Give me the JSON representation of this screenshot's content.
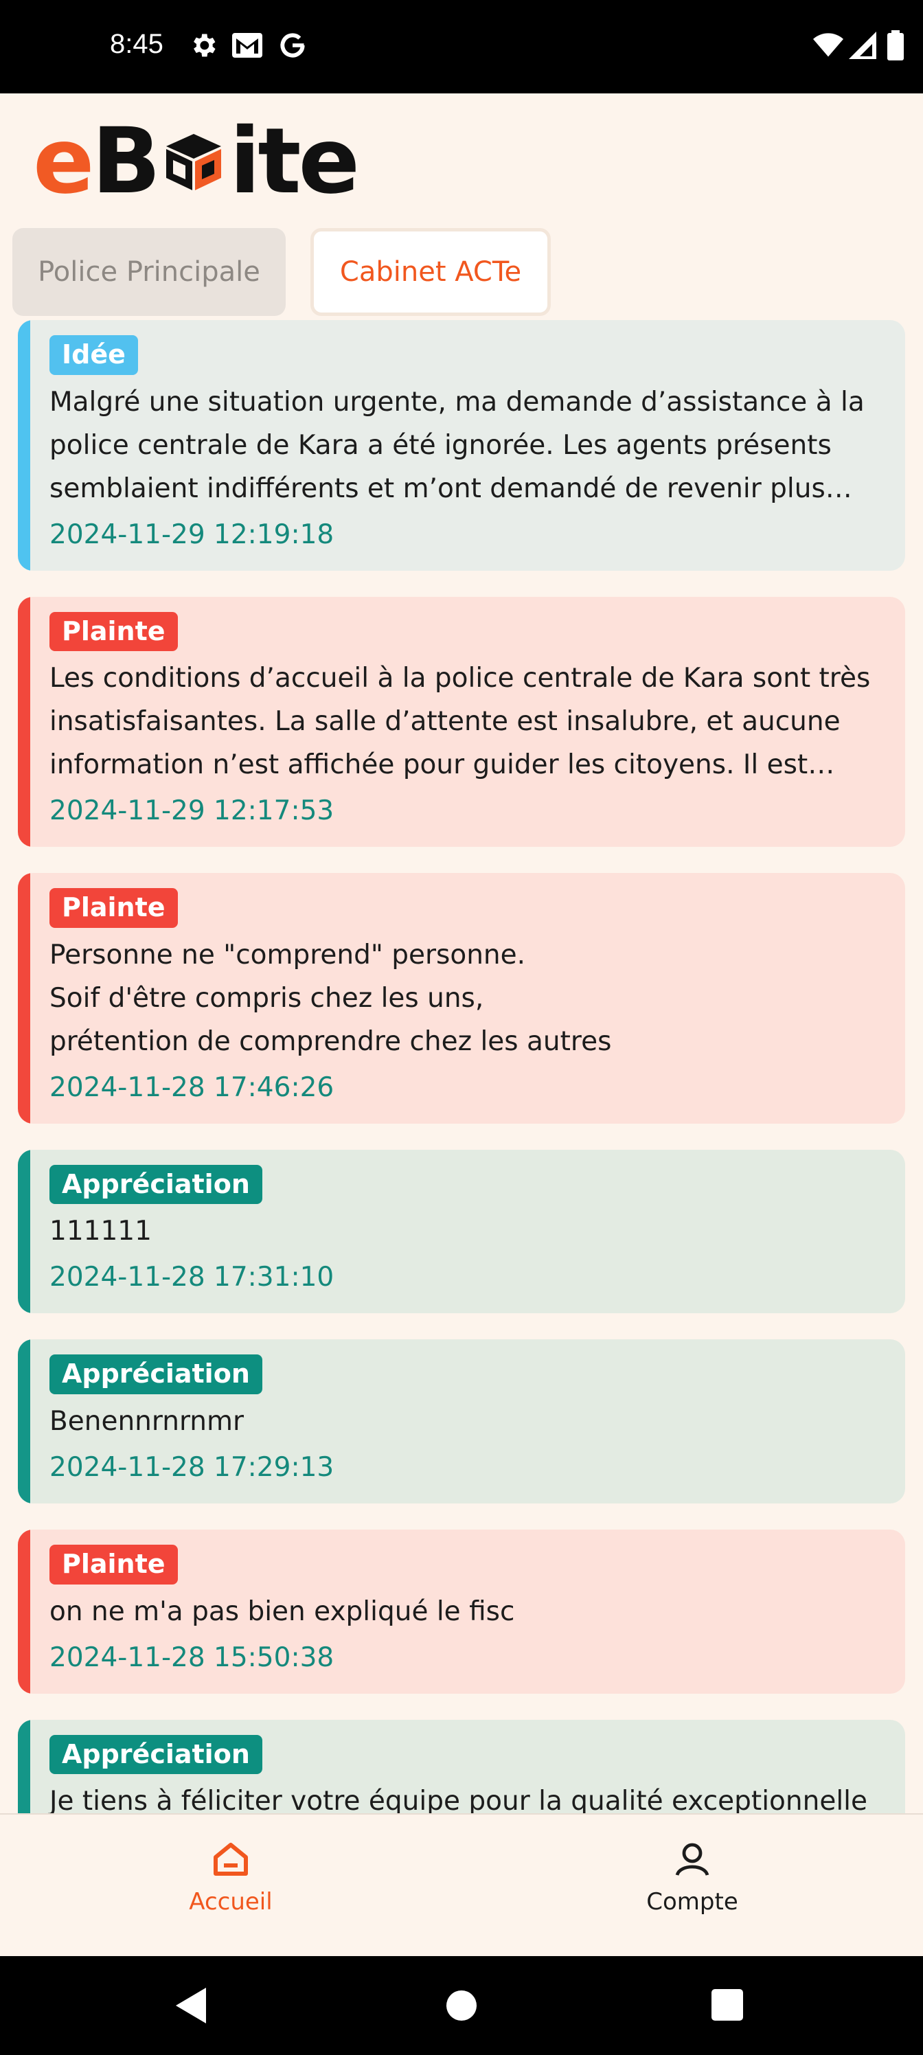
{
  "status_bar": {
    "time": "8:45",
    "left_icons": [
      "settings-icon",
      "gmail-icon",
      "google-icon"
    ],
    "right_icons": [
      "wifi-icon",
      "signal-icon",
      "battery-icon"
    ]
  },
  "app": {
    "logo_text_e": "e",
    "logo_text_b": "B",
    "logo_text_ite": "ite",
    "brand_color": "#f15a24"
  },
  "tabs": [
    {
      "label": "Police Principale",
      "active": false
    },
    {
      "label": "Cabinet ACTe",
      "active": true
    }
  ],
  "feed": [
    {
      "type": "idee",
      "badge": "Idée",
      "text": "Malgré une situation urgente, ma demande d’assistance à la police centrale de Kara a été ignorée. Les agents présents semblaient indifférents et m’ont demandé de revenir plus tar...",
      "date": "2024-11-29 12:19:18"
    },
    {
      "type": "plainte",
      "badge": "Plainte",
      "text": "Les conditions d’accueil à la police centrale de Kara sont très insatisfaisantes. La salle d’attente est insalubre, et aucune information n’est affichée pour guider les citoyens. Il est ess...",
      "date": "2024-11-29 12:17:53"
    },
    {
      "type": "plainte",
      "badge": "Plainte",
      "text": "Personne ne \"comprend\" personne.\nSoif d'être compris chez les uns,\nprétention de comprendre chez les autres",
      "date": "2024-11-28 17:46:26"
    },
    {
      "type": "appreciation",
      "badge": "Appréciation",
      "text": "111111",
      "date": "2024-11-28 17:31:10"
    },
    {
      "type": "appreciation",
      "badge": "Appréciation",
      "text": "Benennrnrnmr",
      "date": "2024-11-28 17:29:13"
    },
    {
      "type": "plainte",
      "badge": "Plainte",
      "text": "on ne m'a pas bien expliqué le fisc",
      "date": "2024-11-28 15:50:38"
    },
    {
      "type": "appreciation",
      "badge": "Appréciation",
      "text": "Je tiens à féliciter votre équipe pour la qualité exceptionnelle du service. J’ai été accueilli chaleureusement, et toutes mes",
      "date": ""
    }
  ],
  "bottom_nav": {
    "home_label": "Accueil",
    "account_label": "Compte",
    "active_color": "#f1571e"
  },
  "colors": {
    "idee": "#52c1ef",
    "plainte": "#f2453a",
    "appreciation": "#0d8f80",
    "date": "#14897c"
  }
}
